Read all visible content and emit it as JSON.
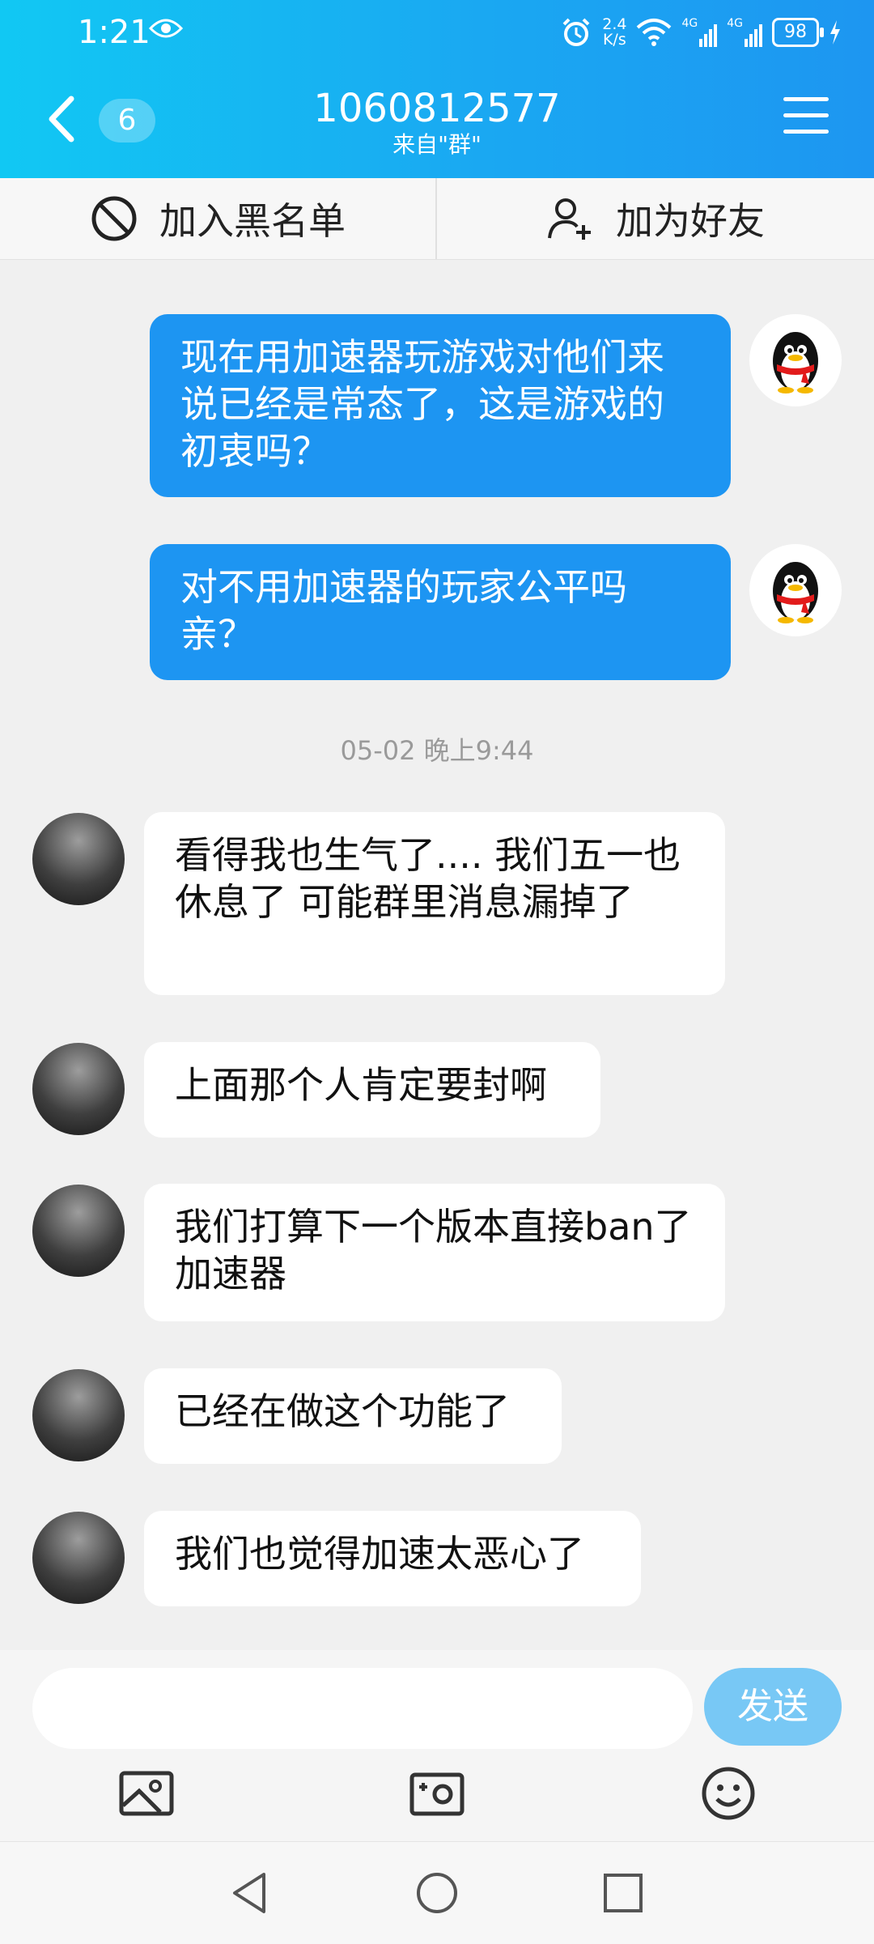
{
  "status_bar": {
    "time": "1:21",
    "network_speed_value": "2.4",
    "network_speed_unit": "K/s",
    "signal1_label": "4G",
    "signal2_label": "4G",
    "battery": "98"
  },
  "header": {
    "unread_count": "6",
    "title": "1060812577",
    "subtitle": "来自\"群\""
  },
  "actions": {
    "blacklist_label": "加入黑名单",
    "add_friend_label": "加为好友"
  },
  "messages": [
    {
      "direction": "out",
      "text": "现在用加速器玩游戏对他们来说已经是常态了，这是游戏的初衷吗？"
    },
    {
      "direction": "out",
      "text": "对不用加速器的玩家公平吗亲？"
    },
    {
      "type": "timestamp",
      "text": "05-02 晚上9:44"
    },
    {
      "direction": "in",
      "text": "看得我也生气了.... 我们五一也休息了 可能群里消息漏掉了"
    },
    {
      "direction": "in",
      "text": "上面那个人肯定要封啊"
    },
    {
      "direction": "in",
      "text": "我们打算下一个版本直接ban了加速器"
    },
    {
      "direction": "in",
      "text": "已经在做这个功能了"
    },
    {
      "direction": "in",
      "text": "我们也觉得加速太恶心了"
    }
  ],
  "input": {
    "placeholder": "",
    "send_label": "发送"
  },
  "toolbar_icons": [
    "image-icon",
    "camera-icon",
    "emoji-icon"
  ],
  "nav_icons": [
    "back-triangle-icon",
    "home-circle-icon",
    "recents-square-icon"
  ],
  "colors": {
    "header_start": "#11c8f3",
    "header_end": "#1d96f1",
    "outgoing_bubble": "#1d95f2",
    "incoming_bubble": "#ffffff",
    "send_button": "#78c8f5"
  }
}
